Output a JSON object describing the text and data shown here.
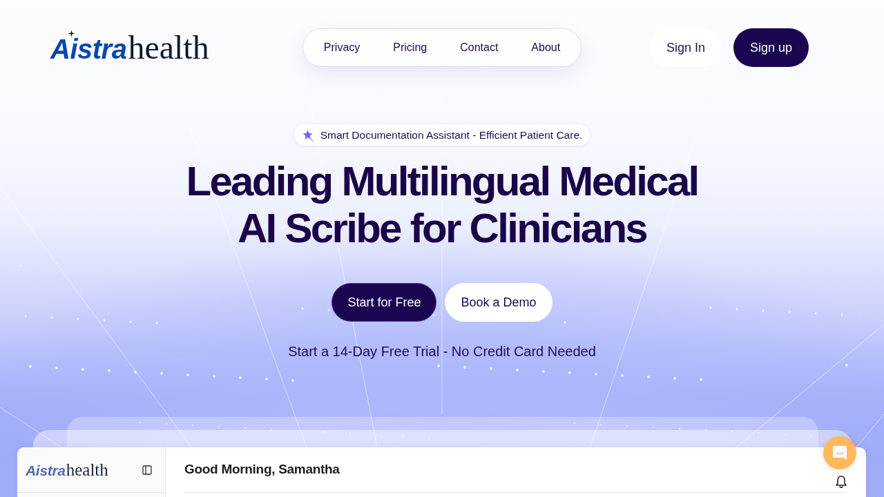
{
  "nav": {
    "logo": {
      "brand": "Aistra",
      "suffix": "health"
    },
    "links": [
      "Privacy",
      "Pricing",
      "Contact",
      "About"
    ],
    "actions": [
      {
        "label": "Sign In",
        "kind": "outline"
      },
      {
        "label": "Sign up",
        "kind": "solid"
      }
    ]
  },
  "hero": {
    "badge": "Smart Documentation Assistant - Efficient Patient Care.",
    "headline_lines": [
      "Leading Multilingual Medical",
      "AI Scribe for Clinicians"
    ],
    "buttons": [
      {
        "label": "Start for Free",
        "kind": "solid"
      },
      {
        "label": "Book a Demo",
        "kind": "outline"
      }
    ],
    "note": "Start a 14-Day Free Trial - No Credit Card Needed"
  },
  "app_preview": {
    "logo": {
      "brand": "Aistra",
      "suffix": "health"
    },
    "greeting": "Good Morning, Samantha"
  }
}
